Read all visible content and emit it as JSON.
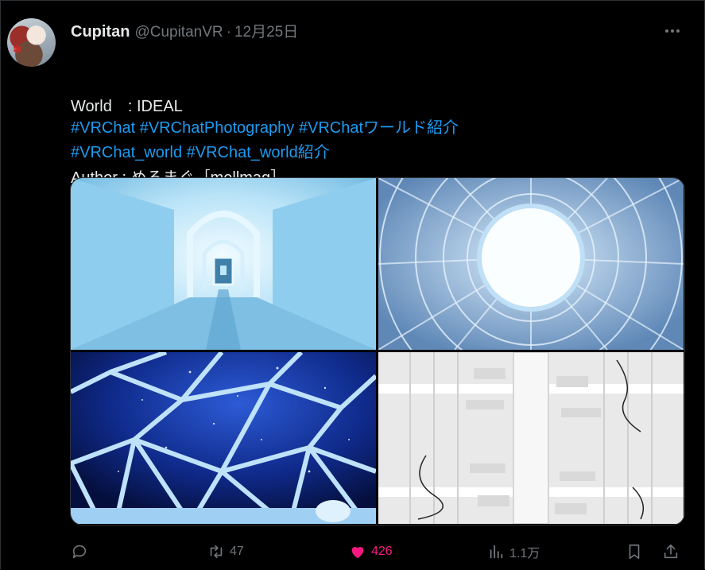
{
  "tweet": {
    "display_name": "Cupitan",
    "handle": "@CupitanVR",
    "separator": "·",
    "date": "12月25日",
    "line1": "World　: IDEAL",
    "line2": "Author : めるまぐ［mellmag］",
    "hashtags_row1": [
      "#VRChat",
      "#VRChatPhotography",
      "#VRChatワールド紹介"
    ],
    "hashtags_row2": [
      "#VRChat_world",
      "#VRChat_world紹介"
    ]
  },
  "media": [
    {
      "name": "corridor-photo",
      "description": "light blue arched corridor"
    },
    {
      "name": "dome-ceiling-photo",
      "description": "circular skylight ceiling"
    },
    {
      "name": "starry-dome-photo",
      "description": "geodesic dome over starry sky"
    },
    {
      "name": "white-tower-photo",
      "description": "white spiral structure"
    }
  ],
  "actions": {
    "reply_count": "",
    "retweet_count": "47",
    "like_count": "426",
    "view_count": "1.1万"
  },
  "colors": {
    "accent": "#1d9bf0",
    "like": "#f91880",
    "muted": "#71767b",
    "text": "#e7e9ea",
    "background": "#000000"
  },
  "icons": [
    "more-icon",
    "reply-icon",
    "retweet-icon",
    "like-icon",
    "views-icon",
    "bookmark-icon",
    "share-icon"
  ]
}
